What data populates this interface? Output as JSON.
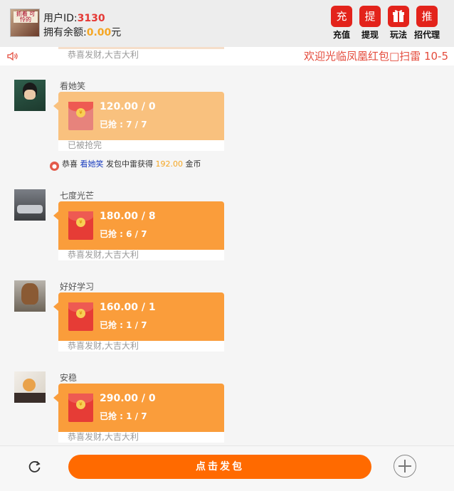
{
  "header": {
    "user_id_label": "用户ID:",
    "user_id": "3130",
    "balance_label": "拥有余额:",
    "balance": "0.00",
    "balance_unit": "元",
    "avatar_text": "抓着 可怜的"
  },
  "actions": [
    {
      "icon_char": "充",
      "label": "充值"
    },
    {
      "icon_char": "提",
      "label": "提现"
    },
    {
      "icon_char": "",
      "label": "玩法"
    },
    {
      "icon_char": "推",
      "label": "招代理"
    }
  ],
  "notice": {
    "marquee": "欢迎光临凤凰红包□扫雷 10-5",
    "partial_footer": "恭喜发财,大吉大利"
  },
  "messages": [
    {
      "name": "看她笑",
      "amount": "120.00 / 0",
      "grabbed": "已抢 : 7 / 7",
      "footer": "已被抢完",
      "bubble_color": "#f9c17e"
    },
    {
      "name": "七度光芒",
      "amount": "180.00 / 8",
      "grabbed": "已抢 : 6 / 7",
      "footer": "恭喜发财,大吉大利",
      "bubble_color": "#fa9d3b"
    },
    {
      "name": "好好学习",
      "amount": "160.00 / 1",
      "grabbed": "已抢 : 1 / 7",
      "footer": "恭喜发财,大吉大利",
      "bubble_color": "#fa9d3b"
    },
    {
      "name": "安稳",
      "amount": "290.00 / 0",
      "grabbed": "已抢 : 1 / 7",
      "footer": "恭喜发财,大吉大利",
      "bubble_color": "#fa9d3b"
    }
  ],
  "system_message": {
    "prefix": "恭喜",
    "who": "看她笑",
    "middle": "发包中雷获得",
    "gold": "192.00",
    "suffix": "金币"
  },
  "bottom": {
    "send_label": "点击发包"
  },
  "colors": {
    "accent": "#ff6a00",
    "action_red": "#e3231b",
    "marquee": "#e44b3c"
  }
}
